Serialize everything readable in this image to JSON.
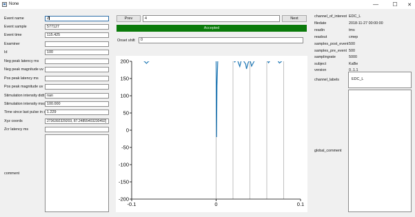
{
  "window": {
    "title": "None",
    "minimize_glyph": "—",
    "maximize_glyph": "☐",
    "close_glyph": "✕"
  },
  "fields": [
    {
      "label": "Event name",
      "value": "Z"
    },
    {
      "label": "Event sample",
      "value": "577127"
    },
    {
      "label": "Event time",
      "value": "115.425"
    },
    {
      "label": "Examiner",
      "value": ""
    },
    {
      "label": "Id",
      "value": "100"
    },
    {
      "label": "Neg peak latency ms",
      "value": ""
    },
    {
      "label": "Neg peak magnitude uv",
      "value": ""
    },
    {
      "label": "Pos peak latency ms",
      "value": ""
    },
    {
      "label": "Pos peak magnitude uv",
      "value": ""
    },
    {
      "label": "Stimulation intensity didt",
      "value": "nan"
    },
    {
      "label": "Stimulation intensity mso",
      "value": "100.000"
    },
    {
      "label": "Time since last pulse in s",
      "value": "1.229"
    },
    {
      "label": "Xyz coords",
      "value": "2736392329203, 87.24855403230492]"
    },
    {
      "label": "Zcr latency ms",
      "value": ""
    }
  ],
  "comment": {
    "label": "comment",
    "value": ""
  },
  "nav": {
    "prev_label": "Prev",
    "next_label": "Next",
    "index_value": "4"
  },
  "status": {
    "text": "Accepted",
    "color": "#0a7a0a"
  },
  "onset": {
    "label": "Onset shift",
    "value": "0"
  },
  "meta": [
    {
      "key": "channel_of_interest",
      "value": "EDC_L"
    },
    {
      "key": "filedate",
      "value": "2018-11-27 00:00:00"
    },
    {
      "key": "readin",
      "value": "tms"
    },
    {
      "key": "readout",
      "value": "cmep"
    },
    {
      "key": "samples_post_event",
      "value": "500"
    },
    {
      "key": "samples_pre_event",
      "value": "500"
    },
    {
      "key": "samplingrate",
      "value": "5000"
    },
    {
      "key": "subject",
      "value": "KaBe"
    },
    {
      "key": "version",
      "value": "0..1.1"
    }
  ],
  "channel_labels": {
    "label": "channel_labels",
    "value": "EDC_L"
  },
  "global_comment": {
    "label": "global_comment",
    "value": ""
  },
  "chart_data": {
    "type": "line",
    "title": "",
    "xlabel": "",
    "ylabel": "",
    "xlim": [
      -0.1,
      0.1
    ],
    "ylim": [
      -200,
      200
    ],
    "xticks": [
      "-0.1",
      "0",
      "0.1"
    ],
    "yticks": [
      "200",
      "150",
      "100",
      "50",
      "0",
      "-50",
      "-100",
      "-150",
      "-200"
    ],
    "grid": false,
    "trace_color": "#1f77b4",
    "marker_color": "#b0b0b0",
    "vertical_markers": [
      0,
      0.02,
      0.04,
      0.06,
      0.08
    ],
    "series": [
      {
        "x": [
          -0.1,
          -0.09,
          -0.085,
          -0.0825,
          -0.08,
          -0.075,
          -0.07,
          -0.06,
          -0.05,
          -0.04,
          -0.03,
          -0.02,
          -0.01,
          -0.001,
          0.0,
          0.0005,
          0.001,
          0.002,
          0.005,
          0.01,
          0.015,
          0.02,
          0.022,
          0.025,
          0.028,
          0.03,
          0.032,
          0.035,
          0.036,
          0.038,
          0.04,
          0.042,
          0.045,
          0.048,
          0.05,
          0.055,
          0.06,
          0.062,
          0.065,
          0.07,
          0.072,
          0.075,
          0.08,
          0.085,
          0.09,
          0.1
        ],
        "y": [
          205,
          205,
          200,
          194,
          200,
          205,
          205,
          205,
          205,
          205,
          205,
          205,
          205,
          205,
          205,
          -20,
          130,
          205,
          205,
          205,
          205,
          205,
          198,
          205,
          185,
          205,
          203,
          192,
          178,
          196,
          205,
          186,
          200,
          205,
          205,
          205,
          205,
          196,
          205,
          205,
          205,
          195,
          205,
          205,
          205,
          205
        ]
      }
    ]
  }
}
